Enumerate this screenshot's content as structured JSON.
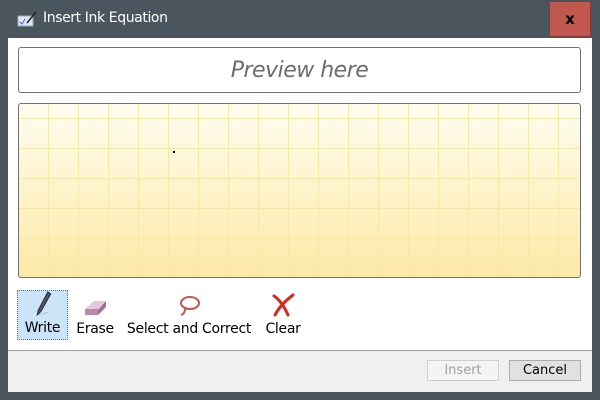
{
  "window": {
    "title": "Insert Ink Equation",
    "close_label": "x"
  },
  "preview": {
    "placeholder": "Preview here"
  },
  "tools": [
    {
      "label": "Write",
      "icon": "pen-icon",
      "active": true
    },
    {
      "label": "Erase",
      "icon": "eraser-icon"
    },
    {
      "label": "Select and Correct",
      "icon": "lasso-icon"
    },
    {
      "label": "Clear",
      "icon": "clear-x-icon"
    }
  ],
  "footer": {
    "insert_label": "Insert",
    "cancel_label": "Cancel"
  }
}
